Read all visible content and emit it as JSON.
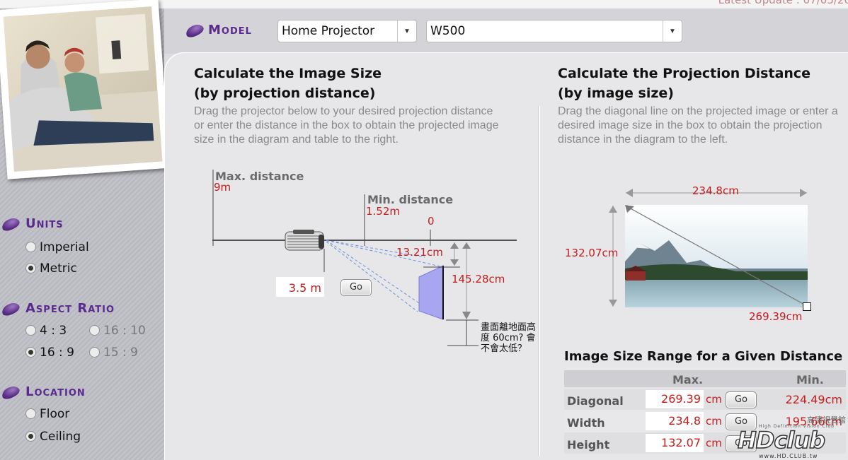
{
  "header": {
    "latest_update": "Latest Update : 07/05/20",
    "model_label": "Model",
    "category_value": "Home Projector",
    "model_value": "W500"
  },
  "sidebar": {
    "units": {
      "title": "Units",
      "options": [
        {
          "label": "Imperial",
          "selected": false
        },
        {
          "label": "Metric",
          "selected": true
        }
      ]
    },
    "aspect": {
      "title": "Aspect Ratio",
      "options": [
        {
          "label": "4 : 3",
          "selected": false,
          "enabled": true
        },
        {
          "label": "16 : 10",
          "selected": false,
          "enabled": false
        },
        {
          "label": "16 : 9",
          "selected": true,
          "enabled": true
        },
        {
          "label": "15 : 9",
          "selected": false,
          "enabled": false
        }
      ]
    },
    "location": {
      "title": "Location",
      "options": [
        {
          "label": "Floor",
          "selected": false
        },
        {
          "label": "Ceiling",
          "selected": true
        }
      ]
    }
  },
  "left": {
    "title_line1": "Calculate the Image Size",
    "title_line2": "(by projection distance)",
    "description": "Drag the projector below to your desired projection distance or enter the distance in the box to obtain the projected image size in the diagram and table to the right.",
    "max_label": "Max. distance",
    "max_value": "9m",
    "min_label": "Min. distance",
    "min_value": "1.52m",
    "zero_label": "0",
    "offset_value": "13.21cm",
    "height_value": "145.28cm",
    "distance_value": "3.5",
    "distance_unit": "m",
    "go_label": "Go",
    "note": "畫面離地面高度 60cm? 會不會太低？"
  },
  "right": {
    "title_line1": "Calculate the Projection Distance",
    "title_line2": "(by image size)",
    "description": "Drag the diagonal line on the projected image or enter a desired image size in the box to obtain the projection distance in the diagram to the left.",
    "width_value": "234.8cm",
    "height_value": "132.07cm",
    "diagonal_value": "269.39cm"
  },
  "table": {
    "title": "Image Size Range for a Given Distance",
    "col_max": "Max.",
    "col_min": "Min.",
    "unit": "cm",
    "go_label": "Go",
    "rows": [
      {
        "label": "Diagonal",
        "max": "269.39",
        "min": "224.49cm"
      },
      {
        "label": "Width",
        "max": "234.8",
        "min": "195.66cm"
      },
      {
        "label": "Height",
        "max": "132.07",
        "min": ""
      }
    ]
  },
  "watermark": {
    "brand": "HDclub",
    "tagline": "High Definition Vision Club",
    "url": "www.HD.CLUB.tw",
    "cjk": "高清視覺館"
  },
  "colors": {
    "accent_purple": "#5a2a8c",
    "value_red": "#c41c1c",
    "panel_gray": "#e7e7ea"
  }
}
